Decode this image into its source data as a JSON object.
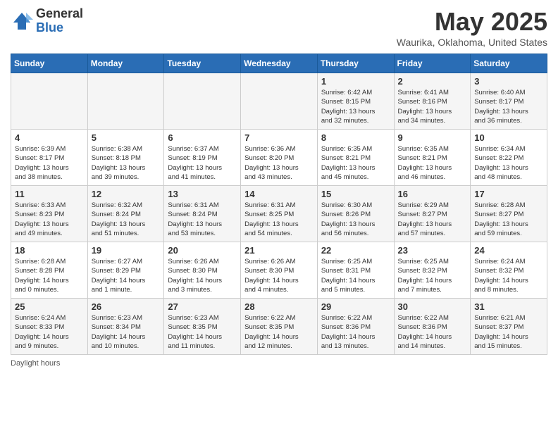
{
  "header": {
    "logo_general": "General",
    "logo_blue": "Blue",
    "month_title": "May 2025",
    "location": "Waurika, Oklahoma, United States"
  },
  "days_of_week": [
    "Sunday",
    "Monday",
    "Tuesday",
    "Wednesday",
    "Thursday",
    "Friday",
    "Saturday"
  ],
  "footer": {
    "daylight_hours_label": "Daylight hours"
  },
  "weeks": [
    [
      {
        "day": "",
        "info": ""
      },
      {
        "day": "",
        "info": ""
      },
      {
        "day": "",
        "info": ""
      },
      {
        "day": "",
        "info": ""
      },
      {
        "day": "1",
        "info": "Sunrise: 6:42 AM\nSunset: 8:15 PM\nDaylight: 13 hours\nand 32 minutes."
      },
      {
        "day": "2",
        "info": "Sunrise: 6:41 AM\nSunset: 8:16 PM\nDaylight: 13 hours\nand 34 minutes."
      },
      {
        "day": "3",
        "info": "Sunrise: 6:40 AM\nSunset: 8:17 PM\nDaylight: 13 hours\nand 36 minutes."
      }
    ],
    [
      {
        "day": "4",
        "info": "Sunrise: 6:39 AM\nSunset: 8:17 PM\nDaylight: 13 hours\nand 38 minutes."
      },
      {
        "day": "5",
        "info": "Sunrise: 6:38 AM\nSunset: 8:18 PM\nDaylight: 13 hours\nand 39 minutes."
      },
      {
        "day": "6",
        "info": "Sunrise: 6:37 AM\nSunset: 8:19 PM\nDaylight: 13 hours\nand 41 minutes."
      },
      {
        "day": "7",
        "info": "Sunrise: 6:36 AM\nSunset: 8:20 PM\nDaylight: 13 hours\nand 43 minutes."
      },
      {
        "day": "8",
        "info": "Sunrise: 6:35 AM\nSunset: 8:21 PM\nDaylight: 13 hours\nand 45 minutes."
      },
      {
        "day": "9",
        "info": "Sunrise: 6:35 AM\nSunset: 8:21 PM\nDaylight: 13 hours\nand 46 minutes."
      },
      {
        "day": "10",
        "info": "Sunrise: 6:34 AM\nSunset: 8:22 PM\nDaylight: 13 hours\nand 48 minutes."
      }
    ],
    [
      {
        "day": "11",
        "info": "Sunrise: 6:33 AM\nSunset: 8:23 PM\nDaylight: 13 hours\nand 49 minutes."
      },
      {
        "day": "12",
        "info": "Sunrise: 6:32 AM\nSunset: 8:24 PM\nDaylight: 13 hours\nand 51 minutes."
      },
      {
        "day": "13",
        "info": "Sunrise: 6:31 AM\nSunset: 8:24 PM\nDaylight: 13 hours\nand 53 minutes."
      },
      {
        "day": "14",
        "info": "Sunrise: 6:31 AM\nSunset: 8:25 PM\nDaylight: 13 hours\nand 54 minutes."
      },
      {
        "day": "15",
        "info": "Sunrise: 6:30 AM\nSunset: 8:26 PM\nDaylight: 13 hours\nand 56 minutes."
      },
      {
        "day": "16",
        "info": "Sunrise: 6:29 AM\nSunset: 8:27 PM\nDaylight: 13 hours\nand 57 minutes."
      },
      {
        "day": "17",
        "info": "Sunrise: 6:28 AM\nSunset: 8:27 PM\nDaylight: 13 hours\nand 59 minutes."
      }
    ],
    [
      {
        "day": "18",
        "info": "Sunrise: 6:28 AM\nSunset: 8:28 PM\nDaylight: 14 hours\nand 0 minutes."
      },
      {
        "day": "19",
        "info": "Sunrise: 6:27 AM\nSunset: 8:29 PM\nDaylight: 14 hours\nand 1 minute."
      },
      {
        "day": "20",
        "info": "Sunrise: 6:26 AM\nSunset: 8:30 PM\nDaylight: 14 hours\nand 3 minutes."
      },
      {
        "day": "21",
        "info": "Sunrise: 6:26 AM\nSunset: 8:30 PM\nDaylight: 14 hours\nand 4 minutes."
      },
      {
        "day": "22",
        "info": "Sunrise: 6:25 AM\nSunset: 8:31 PM\nDaylight: 14 hours\nand 5 minutes."
      },
      {
        "day": "23",
        "info": "Sunrise: 6:25 AM\nSunset: 8:32 PM\nDaylight: 14 hours\nand 7 minutes."
      },
      {
        "day": "24",
        "info": "Sunrise: 6:24 AM\nSunset: 8:32 PM\nDaylight: 14 hours\nand 8 minutes."
      }
    ],
    [
      {
        "day": "25",
        "info": "Sunrise: 6:24 AM\nSunset: 8:33 PM\nDaylight: 14 hours\nand 9 minutes."
      },
      {
        "day": "26",
        "info": "Sunrise: 6:23 AM\nSunset: 8:34 PM\nDaylight: 14 hours\nand 10 minutes."
      },
      {
        "day": "27",
        "info": "Sunrise: 6:23 AM\nSunset: 8:35 PM\nDaylight: 14 hours\nand 11 minutes."
      },
      {
        "day": "28",
        "info": "Sunrise: 6:22 AM\nSunset: 8:35 PM\nDaylight: 14 hours\nand 12 minutes."
      },
      {
        "day": "29",
        "info": "Sunrise: 6:22 AM\nSunset: 8:36 PM\nDaylight: 14 hours\nand 13 minutes."
      },
      {
        "day": "30",
        "info": "Sunrise: 6:22 AM\nSunset: 8:36 PM\nDaylight: 14 hours\nand 14 minutes."
      },
      {
        "day": "31",
        "info": "Sunrise: 6:21 AM\nSunset: 8:37 PM\nDaylight: 14 hours\nand 15 minutes."
      }
    ]
  ]
}
